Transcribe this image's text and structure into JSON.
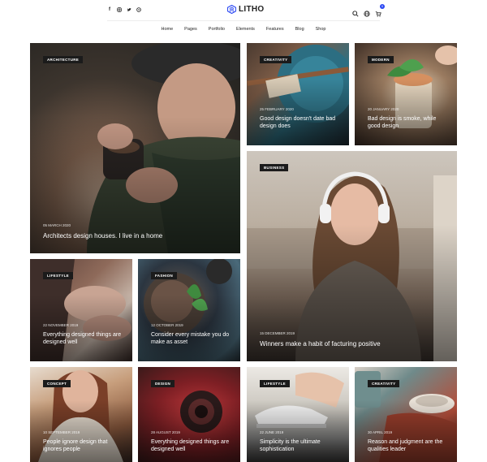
{
  "header": {
    "logo_text": "LITHO",
    "social_icons": [
      "facebook-icon",
      "instagram-icon",
      "twitter-icon",
      "dribbble-icon"
    ],
    "tool_icons": [
      "search-icon",
      "globe-icon",
      "cart-icon"
    ],
    "cart_count": "0",
    "accent_color": "#2946f3"
  },
  "nav": [
    "Home",
    "Pages",
    "Portfolio",
    "Elements",
    "Features",
    "Blog",
    "Shop"
  ],
  "posts": [
    {
      "category": "ARCHITECTURE",
      "date": "05 MARCH 2020",
      "title": "Architects design houses. I live in a home"
    },
    {
      "category": "CREATIVITY",
      "date": "25 FEBRUARY 2020",
      "title": "Good design doesn't date bad design does"
    },
    {
      "category": "MODERN",
      "date": "20 JANUARY 2020",
      "title": "Bad design is smoke, while good design"
    },
    {
      "category": "BUSINESS",
      "date": "15 DECEMBER 2019",
      "title": "Winners make a habit of facturing positive"
    },
    {
      "category": "LIFESTYLE",
      "date": "22 NOVEMBER 2019",
      "title": "Everything designed things are designed well"
    },
    {
      "category": "FASHION",
      "date": "12 OCTOBER 2019",
      "title": "Consider every mistake you do make as asset"
    },
    {
      "category": "CONCEPT",
      "date": "10 SEPTEMBER 2019",
      "title": "People ignore design that ignores people"
    },
    {
      "category": "DESIGN",
      "date": "28 AUGUST 2019",
      "title": "Everything designed things are designed well"
    },
    {
      "category": "LIFESTYLE",
      "date": "22 JUNE 2019",
      "title": "Simplicity is the ultimate sophistication"
    },
    {
      "category": "CREATIVITY",
      "date": "30 APRIL 2019",
      "title": "Reason and judgment are the qualities leader"
    }
  ]
}
